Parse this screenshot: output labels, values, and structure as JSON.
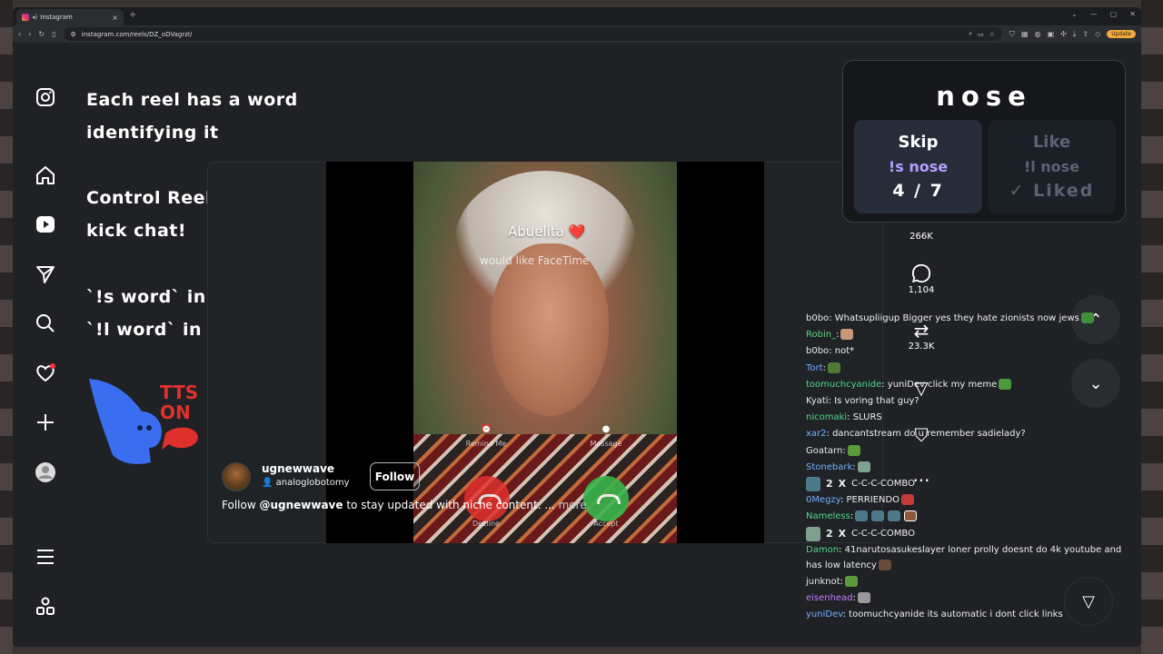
{
  "browser": {
    "tab_title": "Instagram",
    "url": "instagram.com/reels/DZ_oDVagrzI/",
    "update_label": "Update"
  },
  "overlay": {
    "line1": "Each reel has a word",
    "line2": "identifying it",
    "line3": "Control Reels from",
    "line4": "kick chat!",
    "line5": "`!s word` in chat to skip",
    "line6": "`!l word` in chat to like it",
    "tts_line1": "TTS",
    "tts_line2": "ON"
  },
  "reel": {
    "call_name": "Abuelita ❤️",
    "call_sub": "would like FaceTime",
    "remind_label": "Remind Me",
    "message_label": "Message",
    "decline_label": "Decline",
    "accept_label": "Accept",
    "author": "ugnewwave",
    "audio": "analoglobotomy",
    "follow_label": "Follow",
    "caption_pre": "Follow ",
    "caption_handle": "@ugnewwave",
    "caption_post": " to stay updated with niche content. ...",
    "caption_more": " more"
  },
  "actions": {
    "likes": "266K",
    "comments": "1,104",
    "reposts": "23.3K"
  },
  "word_card": {
    "word": "nose",
    "skip_label": "Skip",
    "skip_cmd": "!s nose",
    "skip_count": "4 / 7",
    "like_label": "Like",
    "like_cmd": "!l nose",
    "like_status": "✓ Liked"
  },
  "chat": [
    {
      "user": "b0bo",
      "color": "#e8e8e8",
      "text": ": Whatsupliigup Bigger yes they hate zionists now jews"
    },
    {
      "user": "Robin_",
      "color": "#61d17b",
      "text": ":"
    },
    {
      "user": "b0bo",
      "color": "#e8e8e8",
      "text": ": not*"
    },
    {
      "user": "Tort",
      "color": "#6fa8ff",
      "text": ":"
    },
    {
      "user": "toomuchcyanide",
      "color": "#54d48a",
      "text": ": yuniDev click my meme"
    },
    {
      "user": "Kyati",
      "color": "#e8e8e8",
      "text": ": Is      voring that guy?"
    },
    {
      "user": "nicomaki",
      "color": "#54d48a",
      "text": ":       SLURS"
    },
    {
      "user": "xar2",
      "color": "#6fb0ff",
      "text": ": dancantstream do u remember sadielady?"
    },
    {
      "user": "Goatarn",
      "color": "#e8e8e8",
      "text": ":"
    },
    {
      "user": "Stonebark",
      "color": "#6fb0ff",
      "text": ":"
    },
    {
      "user": "0Megzy",
      "color": "#6fb0ff",
      "text": ": PERRIENDO"
    },
    {
      "user": "Nameless",
      "color": "#54d48a",
      "text": ":"
    },
    {
      "user": "Damon",
      "color": "#54d48a",
      "text": ": 41narutosasukeslayer loner prolly doesnt do 4k youtube and has low latency"
    },
    {
      "user": "junknot",
      "color": "#e8e8e8",
      "text": ":"
    },
    {
      "user": "eisenhead",
      "color": "#c77dff",
      "text": ":"
    },
    {
      "user": "yuniDev",
      "color": "#6fb0ff",
      "text": ": toomuchcyanide its automatic i dont click links"
    }
  ],
  "combos": [
    {
      "count": "2",
      "x": "X",
      "label": "C-C-C-COMBO"
    },
    {
      "count": "2",
      "x": "X",
      "label": "C-C-C-COMBO"
    }
  ],
  "colors": {
    "page_bg": "#1f2124",
    "accent_purple": "#b4a0ff",
    "mascot_blue": "#3a6df0",
    "tts_red": "#e0302c"
  }
}
